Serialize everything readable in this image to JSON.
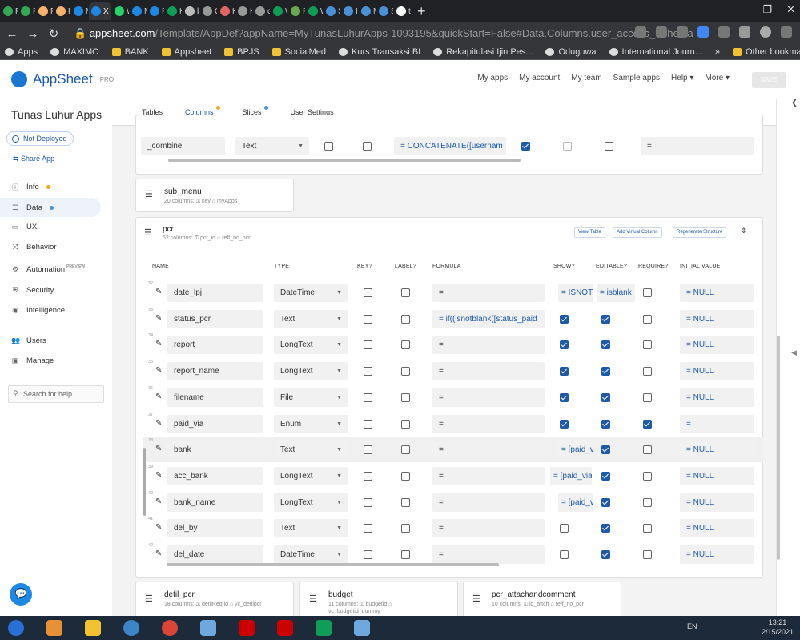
{
  "browser": {
    "tabs": [
      {
        "label": "P",
        "color": "#35a853"
      },
      {
        "label": "P",
        "color": "#35a853"
      },
      {
        "label": "P",
        "color": "#f6b26b"
      },
      {
        "label": "P",
        "color": "#f6b26b"
      },
      {
        "label": "M",
        "color": "#1e88e5"
      },
      {
        "label": "X",
        "color": "#1e88e5",
        "active": true
      },
      {
        "label": "W",
        "color": "#25d366"
      },
      {
        "label": "M",
        "color": "#1e88e5"
      },
      {
        "label": "P",
        "color": "#1e88e5"
      },
      {
        "label": "K",
        "color": "#0f9d58"
      },
      {
        "label": "b",
        "color": "#bbbbbb"
      },
      {
        "label": "C",
        "color": "#999999"
      },
      {
        "label": "K",
        "color": "#e06666"
      },
      {
        "label": "K",
        "color": "#999999"
      },
      {
        "label": "cl",
        "color": "#999999"
      },
      {
        "label": "W",
        "color": "#0f9d58"
      },
      {
        "label": "P",
        "color": "#6aa84f"
      },
      {
        "label": "W",
        "color": "#0f9d58"
      },
      {
        "label": "S",
        "color": "#4a90d9"
      },
      {
        "label": "Ir",
        "color": "#4a90d9"
      },
      {
        "label": "M",
        "color": "#4a90d9"
      },
      {
        "label": "S",
        "color": "#4a90d9"
      },
      {
        "label": "tr",
        "color": "#ffffff"
      }
    ],
    "new_tab": "+",
    "url_host": "appsheet.com",
    "url_rest": "/Template/AppDef?appName=MyTunasLuhurApps-1093195&quickStart=False#Data.Columns.user_access_Schema",
    "bookmarks": [
      "Apps",
      "MAXIMO",
      "BANK",
      "Appsheet",
      "BPJS",
      "SocialMed",
      "Kurs Transaksi BI",
      "Rekapitulasi Ijin Pes...",
      "Oduguwa",
      "International Journ..."
    ],
    "bookmarks_more": "»",
    "other_bookmarks": "Other bookmarks"
  },
  "app": {
    "brand": "AppSheet",
    "brand_tier": "PRO",
    "top_nav": [
      "My apps",
      "My account",
      "My team",
      "Sample apps",
      "Help ▾",
      "More ▾"
    ],
    "save_label": "SAVE",
    "app_name": "Tunas Luhur Apps",
    "deploy_status": "Not Deployed",
    "share_label": "Share App",
    "nav": [
      {
        "label": "Info",
        "icon": "info-icon",
        "glyph": "ⓘ",
        "dot": "#f5a623"
      },
      {
        "label": "Data",
        "icon": "data-icon",
        "glyph": "☰",
        "dot": "#4a90d9",
        "selected": true
      },
      {
        "label": "UX",
        "icon": "ux-icon",
        "glyph": "▭"
      },
      {
        "label": "Behavior",
        "icon": "behavior-icon",
        "glyph": "⤨"
      },
      {
        "label": "Automation",
        "icon": "automation-icon",
        "glyph": "⚙",
        "badge": "PREVIEW"
      },
      {
        "label": "Security",
        "icon": "security-icon",
        "glyph": "⛨"
      },
      {
        "label": "Intelligence",
        "icon": "intelligence-icon",
        "glyph": "◉"
      },
      {
        "label": "Users",
        "icon": "users-icon",
        "glyph": "👥"
      },
      {
        "label": "Manage",
        "icon": "manage-icon",
        "glyph": "▣"
      }
    ],
    "search_help": "Search for help",
    "data_tabs": [
      {
        "label": "Tables"
      },
      {
        "label": "Columns",
        "dot": "#f5a623",
        "active": true
      },
      {
        "label": "Slices",
        "dot": "#4a90d9"
      },
      {
        "label": "User Settings"
      }
    ]
  },
  "top_card": {
    "row": {
      "name": "_combine",
      "type": "Text",
      "formula": "= CONCATENATE([usernam",
      "initial": "="
    }
  },
  "sub_menu": {
    "name": "sub_menu",
    "columns": "20 columns:",
    "key": "key",
    "label": "myApps"
  },
  "pcr": {
    "name": "pcr",
    "columns": "52 columns:",
    "key": "pcr_id",
    "label": "reff_no_pcr",
    "buttons": [
      "View Table",
      "Add Virtual Column",
      "Regenerate Structure"
    ],
    "headers": [
      "NAME",
      "TYPE",
      "KEY?",
      "LABEL?",
      "FORMULA",
      "SHOW?",
      "EDITABLE?",
      "REQUIRE?",
      "INITIAL VALUE"
    ],
    "rows": [
      {
        "num": "32",
        "name": "date_lpj",
        "type": "DateTime",
        "key": false,
        "label": false,
        "formula": "=",
        "show": "= ISNOTE",
        "editable": "= isblank",
        "require": false,
        "initial": "= NULL"
      },
      {
        "num": "33",
        "name": "status_pcr",
        "type": "Text",
        "key": false,
        "label": false,
        "formula": "= if((isnotblank([status_paid",
        "show": true,
        "editable": true,
        "require": false,
        "initial": "= NULL"
      },
      {
        "num": "34",
        "name": "report",
        "type": "LongText",
        "key": false,
        "label": false,
        "formula": "=",
        "show": true,
        "editable": true,
        "require": false,
        "initial": "= NULL"
      },
      {
        "num": "35",
        "name": "report_name",
        "type": "LongText",
        "key": false,
        "label": false,
        "formula": "=",
        "show": true,
        "editable": true,
        "require": false,
        "initial": "= NULL"
      },
      {
        "num": "36",
        "name": "filename",
        "type": "File",
        "key": false,
        "label": false,
        "formula": "=",
        "show": true,
        "editable": true,
        "require": false,
        "initial": "= NULL"
      },
      {
        "num": "37",
        "name": "paid_via",
        "type": "Enum",
        "key": false,
        "label": false,
        "formula": "=",
        "show": true,
        "editable": true,
        "require": true,
        "initial": "="
      },
      {
        "num": "38",
        "name": "bank",
        "type": "Text",
        "key": false,
        "label": false,
        "formula": "=",
        "show": "= [paid_v",
        "editable": true,
        "require": false,
        "initial": "= NULL"
      },
      {
        "num": "39",
        "name": "acc_bank",
        "type": "LongText",
        "key": false,
        "label": false,
        "formula": "=",
        "show": "= [paid_via",
        "editable": true,
        "require": false,
        "initial": "= NULL"
      },
      {
        "num": "40",
        "name": "bank_name",
        "type": "LongText",
        "key": false,
        "label": false,
        "formula": "=",
        "show": "= [paid_v",
        "editable": true,
        "require": false,
        "initial": "= NULL"
      },
      {
        "num": "41",
        "name": "del_by",
        "type": "Text",
        "key": false,
        "label": false,
        "formula": "=",
        "show": false,
        "editable": true,
        "require": false,
        "initial": "= NULL"
      },
      {
        "num": "42",
        "name": "del_date",
        "type": "DateTime",
        "key": false,
        "label": false,
        "formula": "=",
        "show": false,
        "editable": true,
        "require": false,
        "initial": "= NULL"
      }
    ]
  },
  "bottom_tables": [
    {
      "name": "detil_pcr",
      "columns": "18 columns:",
      "key": "detilReq id",
      "label": "vc_detilpcr",
      "extra": ""
    },
    {
      "name": "budget",
      "columns": "11 columns:",
      "key": "budgetid",
      "label": "",
      "extra": "vc_budgetid_dummy"
    },
    {
      "name": "pcr_attachandcomment",
      "columns": "10 columns:",
      "key": "id_attch",
      "label": "reff_no_pcr",
      "extra": ""
    }
  ],
  "taskbar": {
    "lang": "EN",
    "time": "13:21",
    "date": "2/15/2021"
  },
  "colors": {
    "accent": "#1e5aa8",
    "checkbox_on": "#1e5aa8"
  }
}
